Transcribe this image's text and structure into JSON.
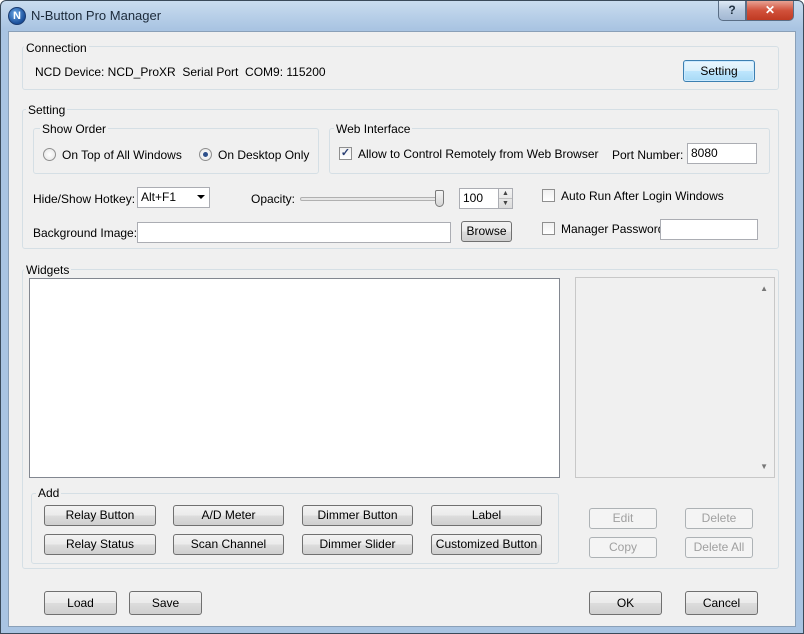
{
  "window": {
    "title": "N-Button Pro Manager",
    "icon_letter": "N",
    "help_label": "?",
    "close_label": "✕"
  },
  "connection": {
    "group_label": "Connection",
    "device_text": "NCD Device: NCD_ProXR  Serial Port  COM9: 115200",
    "setting_button": "Setting"
  },
  "setting": {
    "group_label": "Setting",
    "show_order": {
      "label": "Show Order",
      "option_top": "On Top of All Windows",
      "option_desktop": "On Desktop Only",
      "selected": "option_desktop"
    },
    "web_interface": {
      "label": "Web Interface",
      "allow_remote": "Allow to Control Remotely from Web Browser",
      "allow_remote_checked": true,
      "port_label": "Port Number:",
      "port_value": "8080"
    },
    "hotkey_label": "Hide/Show Hotkey:",
    "hotkey_value": "Alt+F1",
    "opacity_label": "Opacity:",
    "opacity_value": "100",
    "opacity_level": 1.0,
    "auto_run_label": "Auto Run After Login Windows",
    "auto_run_checked": false,
    "background_label": "Background Image:",
    "background_value": "",
    "browse_button": "Browse",
    "manager_password_label": "Manager Password",
    "manager_password_checked": false,
    "manager_password_value": ""
  },
  "widgets": {
    "group_label": "Widgets",
    "add": {
      "label": "Add",
      "buttons": [
        "Relay Button",
        "A/D Meter",
        "Dimmer Button",
        "Label",
        "Relay Status",
        "Scan Channel",
        "Dimmer Slider",
        "Customized Button"
      ]
    },
    "edit_button": "Edit",
    "delete_button": "Delete",
    "copy_button": "Copy",
    "delete_all_button": "Delete All",
    "scroll_up": "▲",
    "scroll_down": "▼"
  },
  "footer": {
    "load_button": "Load",
    "save_button": "Save",
    "ok_button": "OK",
    "cancel_button": "Cancel"
  },
  "colors": {
    "title_gradient_top": "#c9dcef",
    "title_gradient_bottom": "#a9c4e2",
    "close_red": "#c03a22",
    "client_bg": "#f0f0f0",
    "focus_blue": "#3c7fb1"
  }
}
